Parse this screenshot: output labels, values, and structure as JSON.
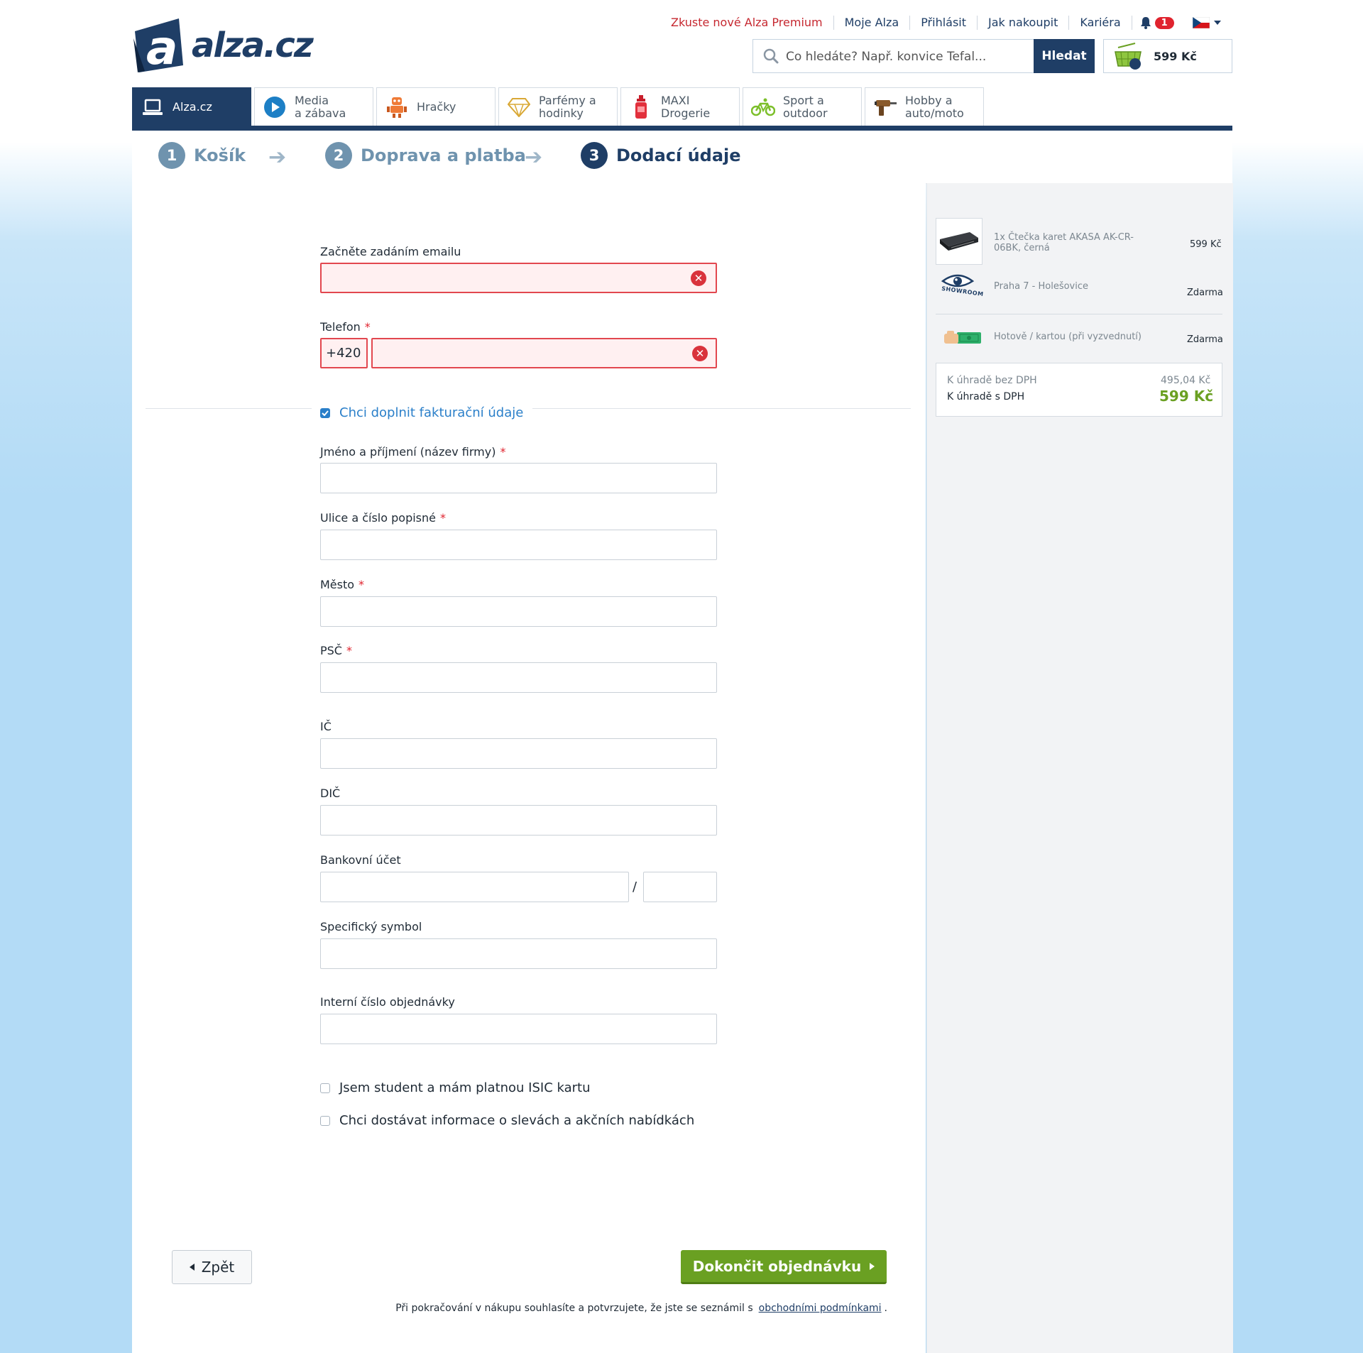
{
  "header": {
    "logo_text": "alza.cz",
    "links": [
      "Zkuste nové Alza Premium",
      "Moje Alza",
      "Přihlásit",
      "Jak nakoupit",
      "Kariéra"
    ],
    "notifications_count": "1",
    "search_placeholder": "Co hledáte? Např. konvice Tefal...",
    "search_button": "Hledat",
    "cart_count": "1",
    "cart_total": "599 Kč"
  },
  "tabs": [
    {
      "line1": "Alza.cz",
      "line2": "",
      "icon": "laptop-icon"
    },
    {
      "line1": "Media",
      "line2": "a zábava",
      "icon": "play-icon"
    },
    {
      "line1": "Hračky",
      "line2": "",
      "icon": "robot-icon"
    },
    {
      "line1": "Parfémy a",
      "line2": "hodinky",
      "icon": "diamond-icon"
    },
    {
      "line1": "MAXI",
      "line2": "Drogerie",
      "icon": "bottle-icon"
    },
    {
      "line1": "Sport a",
      "line2": "outdoor",
      "icon": "bicycle-icon"
    },
    {
      "line1": "Hobby a",
      "line2": "auto/moto",
      "icon": "drill-icon"
    }
  ],
  "steps": [
    {
      "num": "1",
      "label": "Košík"
    },
    {
      "num": "2",
      "label": "Doprava a platba"
    },
    {
      "num": "3",
      "label": "Dodací údaje"
    }
  ],
  "form": {
    "email_label": "Začněte zadáním emailu",
    "phone_label": "Telefon",
    "phone_prefix": "+420",
    "billing_checkbox": "Chci doplnit fakturační údaje",
    "name_label": "Jméno a příjmení (název firmy)",
    "street_label": "Ulice a číslo popisné",
    "city_label": "Město",
    "zip_label": "PSČ",
    "ic_label": "IČ",
    "dic_label": "DIČ",
    "bank_label": "Bankovní účet",
    "bank_separator": "/",
    "symbol_label": "Specifický symbol",
    "order_label": "Interní číslo objednávky",
    "student_checkbox": "Jsem student a mám platnou ISIC kartu",
    "newsletter_checkbox": "Chci dostávat informace o slevách a akčních nabídkách",
    "required_mark": "*"
  },
  "footer": {
    "back_button": "Zpět",
    "finish_button": "Dokončit objednávku",
    "terms_text": "Při pokračování v nákupu souhlasíte a potvrzujete, že jste se seznámil s",
    "terms_link": "obchodními podmínkami",
    "terms_end": "."
  },
  "summary": {
    "item": "1x Čtečka karet AKASA AK-CR-06BK, černá",
    "item_price": "599 Kč",
    "showroom_logo_text": "SHOWROOM",
    "pickup": "Praha 7 - Holešovice",
    "pickup_price": "Zdarma",
    "payment": "Hotově / kartou (při vyzvednutí)",
    "payment_price": "Zdarma",
    "without_vat_label": "K úhradě bez DPH",
    "without_vat": "495,04 Kč",
    "with_vat_label": "K úhradě s DPH",
    "with_vat": "599 Kč"
  },
  "colors": {
    "brand": "#1f3e66",
    "error": "#e2474f",
    "accent_green": "#6aa022",
    "link_blue": "#2a7fc9"
  }
}
